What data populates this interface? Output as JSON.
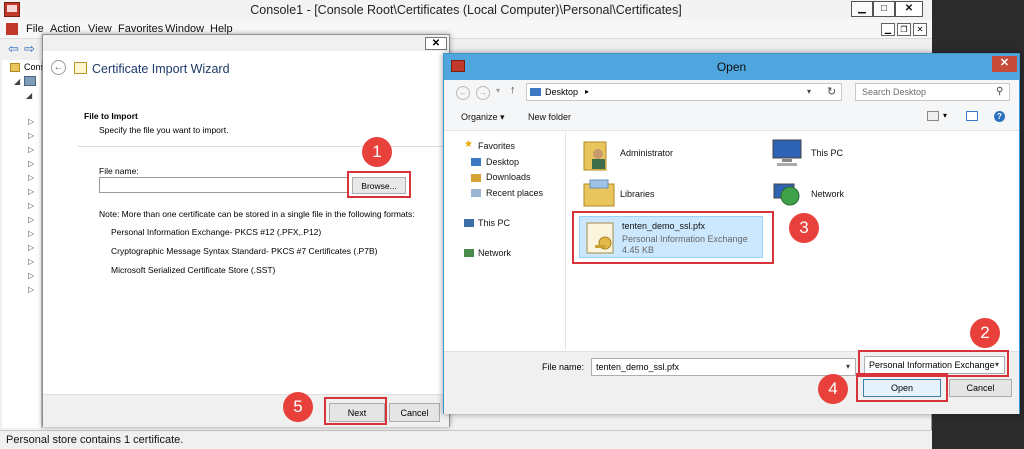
{
  "console": {
    "title": "Console1 - [Console Root\\Certificates (Local Computer)\\Personal\\Certificates]",
    "menu": [
      "File",
      "Action",
      "View",
      "Favorites",
      "Window",
      "Help"
    ],
    "tree_partial_label": "Conso",
    "status": "Personal store contains 1 certificate."
  },
  "wizard": {
    "title": "Certificate Import Wizard",
    "heading": "File to Import",
    "subheading": "Specify the file you want to import.",
    "file_label": "File name:",
    "file_value": "",
    "browse_label": "Browse...",
    "note": "Note:  More than one certificate can be stored in a single file in the following formats:",
    "formats": [
      "Personal Information Exchange- PKCS #12 (.PFX,.P12)",
      "Cryptographic Message Syntax Standard- PKCS #7 Certificates (.P7B)",
      "Microsoft Serialized Certificate Store (.SST)"
    ],
    "next_label": "Next",
    "cancel_label": "Cancel"
  },
  "open_dialog": {
    "title": "Open",
    "address": "Desktop",
    "search_placeholder": "Search Desktop",
    "organize_label": "Organize",
    "new_folder_label": "New folder",
    "nav": {
      "favorites": "Favorites",
      "desktop": "Desktop",
      "downloads": "Downloads",
      "recent": "Recent places",
      "this_pc": "This PC",
      "network": "Network"
    },
    "items": {
      "administrator": "Administrator",
      "this_pc": "This PC",
      "libraries": "Libraries",
      "network": "Network"
    },
    "selected_file": {
      "name": "tenten_demo_ssl.pfx",
      "type": "Personal Information Exchange",
      "size": "4.45 KB"
    },
    "file_name_label": "File name:",
    "file_name_value": "tenten_demo_ssl.pfx",
    "file_type": "Personal Information Exchange",
    "open_label": "Open",
    "cancel_label": "Cancel"
  },
  "steps": [
    "1",
    "2",
    "3",
    "4",
    "5"
  ],
  "colors": {
    "highlight": "#d6333a",
    "badge": "#e8413c",
    "titlebar_blue": "#4fa6df",
    "selection": "#cce8ff"
  }
}
